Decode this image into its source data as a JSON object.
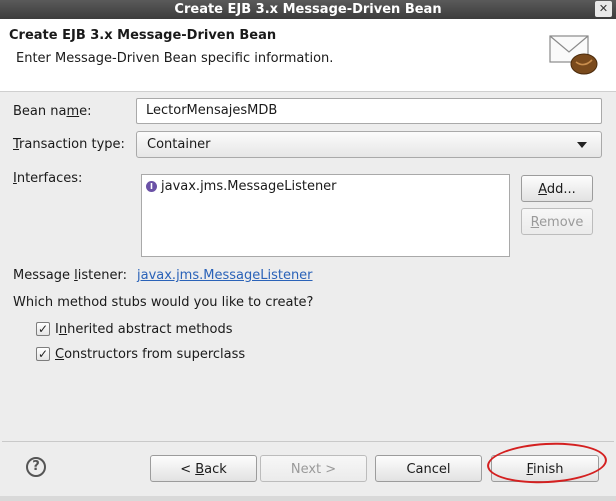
{
  "window": {
    "title": "Create EJB 3.x Message-Driven Bean",
    "close_glyph": "✕"
  },
  "header": {
    "title": "Create EJB 3.x Message-Driven Bean",
    "subtitle": "Enter Message-Driven Bean specific information.",
    "icon": "mail-bean-icon"
  },
  "form": {
    "bean_name": {
      "label_pre": "Bean na",
      "label_mn": "m",
      "label_post": "e:",
      "value": "LectorMensajesMDB"
    },
    "transaction_type": {
      "label_mn": "T",
      "label_post": "ransaction type:",
      "value": "Container"
    },
    "interfaces": {
      "label_mn": "I",
      "label_post": "nterfaces:",
      "items": [
        "javax.jms.MessageListener"
      ],
      "add_mn": "A",
      "add_post": "dd...",
      "remove_mn": "R",
      "remove_post": "emove"
    },
    "message_listener": {
      "label_pre": "Message ",
      "label_mn": "l",
      "label_post": "istener:",
      "value": "javax.jms.MessageListener"
    },
    "stubs_question": "Which method stubs would you like to create?",
    "checkboxes": [
      {
        "pre": "I",
        "mn": "n",
        "post": "herited abstract methods",
        "checked": true
      },
      {
        "pre": "",
        "mn": "C",
        "post": "onstructors from superclass",
        "checked": true
      }
    ]
  },
  "buttons": {
    "back": "< Back",
    "back_pre": "< ",
    "back_mn": "B",
    "back_post": "ack",
    "next": "Next >",
    "cancel": "Cancel",
    "finish": "Finish",
    "finish_mn": "F",
    "finish_post": "inish"
  },
  "help_glyph": "?",
  "colors": {
    "link": "#2a62b8",
    "highlight_ring": "#d42020"
  }
}
